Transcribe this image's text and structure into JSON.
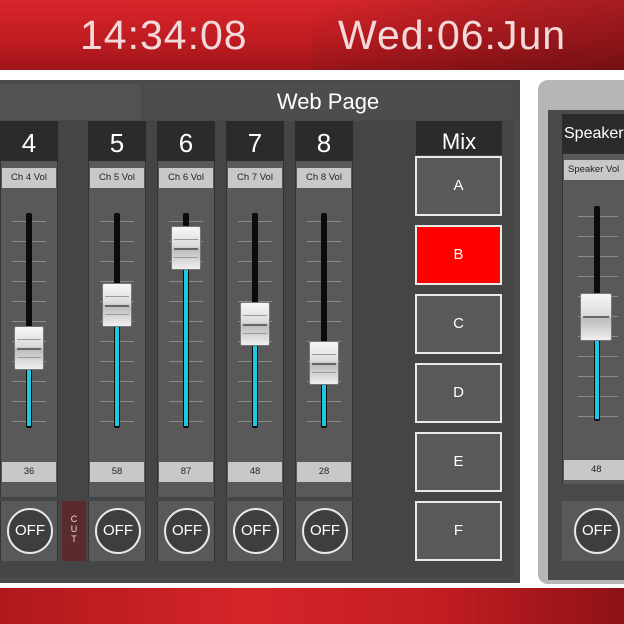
{
  "header": {
    "time": "14:34:08",
    "date": "Wed:06:Jun"
  },
  "panel": {
    "title": "Web Page"
  },
  "channels": [
    {
      "number": "4",
      "label": "Ch 4 Vol",
      "value": "36",
      "level": 36,
      "off_label": "OFF"
    },
    {
      "number": "5",
      "label": "Ch 5 Vol",
      "value": "58",
      "level": 58,
      "off_label": "OFF"
    },
    {
      "number": "6",
      "label": "Ch 6 Vol",
      "value": "87",
      "level": 87,
      "off_label": "OFF"
    },
    {
      "number": "7",
      "label": "Ch 7 Vol",
      "value": "48",
      "level": 48,
      "off_label": "OFF"
    },
    {
      "number": "8",
      "label": "Ch 8 Vol",
      "value": "28",
      "level": 28,
      "off_label": "OFF"
    }
  ],
  "cut_label": [
    "C",
    "U",
    "T"
  ],
  "mix": {
    "title": "Mix",
    "buttons": [
      "A",
      "B",
      "C",
      "D",
      "E",
      "F"
    ],
    "active": "B",
    "active_color": "#ff0000"
  },
  "speakers": {
    "title": "Speakers",
    "label": "Speaker Vol",
    "value": "48",
    "level": 48,
    "off_label": "OFF"
  },
  "colors": {
    "header_red": "#c01c22",
    "fader_fill": "#1ec8e0",
    "panel_bg": "#4a4a4a"
  }
}
